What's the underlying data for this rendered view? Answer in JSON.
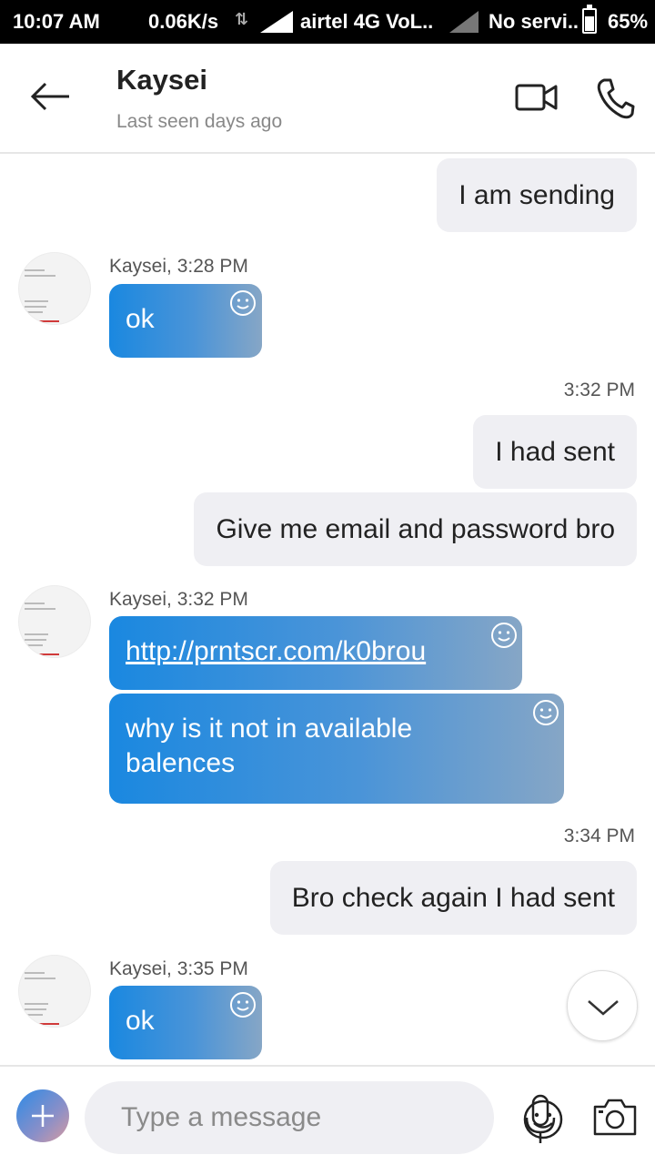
{
  "status_bar": {
    "time": "10:07 AM",
    "net_speed": "0.06K/s",
    "carrier": "airtel 4G VoL..",
    "no_service": "No servi..",
    "battery_level": 0.65,
    "battery": "65%"
  },
  "header": {
    "contact_name": "Kaysei",
    "status": "Last seen days ago"
  },
  "messages": {
    "m1_out": "I am sending",
    "g1_sender": "Kaysei, 3:28 PM",
    "m2_in": "ok",
    "t1": "3:32 PM",
    "m3_out": "I had sent",
    "m4_out": "Give me email and password bro",
    "g2_sender": "Kaysei, 3:32 PM",
    "m5_in_link": "http://prntscr.com/k0brou",
    "m6_in_line1": "why is it not in available",
    "m6_in_line2": "balences",
    "t2": "3:34 PM",
    "m7_out": "Bro check again I had sent",
    "g3_sender": "Kaysei, 3:35 PM",
    "m8_in": "ok"
  },
  "composer": {
    "placeholder": "Type a message"
  },
  "colors": {
    "incoming_bubble_start": "#1a88e0",
    "incoming_bubble_end": "#86a6c6",
    "outgoing_bubble": "#efeff3"
  }
}
